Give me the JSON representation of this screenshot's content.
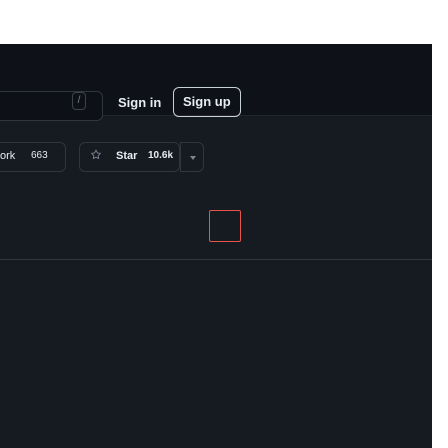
{
  "header": {
    "search": {
      "shortcut": "/"
    },
    "signin_label": "Sign in",
    "signup_label": "Sign up"
  },
  "repo_actions": {
    "fork": {
      "label": "ork",
      "count": "663"
    },
    "star": {
      "label": "Star",
      "count": "10.6k"
    }
  },
  "colors": {
    "page_background": "#ffffff",
    "app_background": "#161b22",
    "header_background": "#0e1117",
    "border": "#30363d",
    "text": "#e6edf3",
    "focus_outline": "#e5534b"
  },
  "icons": {
    "star": "star-icon",
    "caret": "chevron-down-icon"
  }
}
